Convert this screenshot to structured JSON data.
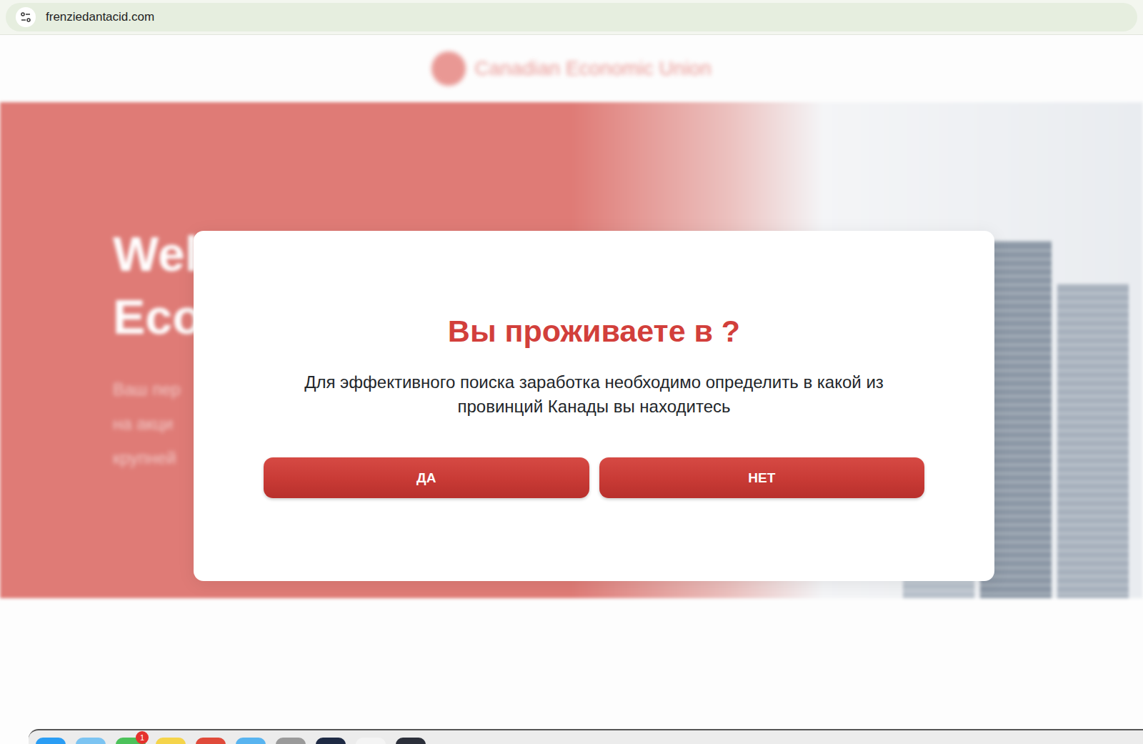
{
  "browser": {
    "url": "frenziedantacid.com"
  },
  "header": {
    "logo": "Canadian Economic Union"
  },
  "hero": {
    "title_lines": [
      "Wel",
      "Eco"
    ],
    "subtitle_lines": [
      "Ваш пер",
      "на акци",
      "крупней"
    ]
  },
  "modal": {
    "title": "Вы проживаете в ?",
    "text": "Для эффективного поиска заработка необходимо определить в какой из провинций Канады вы находитесь",
    "buttons": [
      "ДА",
      "НЕТ"
    ]
  },
  "dock": {
    "items": [
      {
        "color": "#2a9df4",
        "badge": ""
      },
      {
        "color": "#7cc4f2",
        "badge": ""
      },
      {
        "color": "#4cc25a",
        "badge": "1"
      },
      {
        "color": "#f5d44a",
        "badge": ""
      },
      {
        "color": "#e04a3a",
        "badge": ""
      },
      {
        "color": "#58b4f0",
        "badge": ""
      },
      {
        "color": "#9a9a9a",
        "badge": ""
      },
      {
        "color": "#1e2a44",
        "badge": ""
      },
      {
        "color": "#f4f4f4",
        "badge": ""
      },
      {
        "color": "#2b2f3a",
        "badge": ""
      }
    ]
  }
}
